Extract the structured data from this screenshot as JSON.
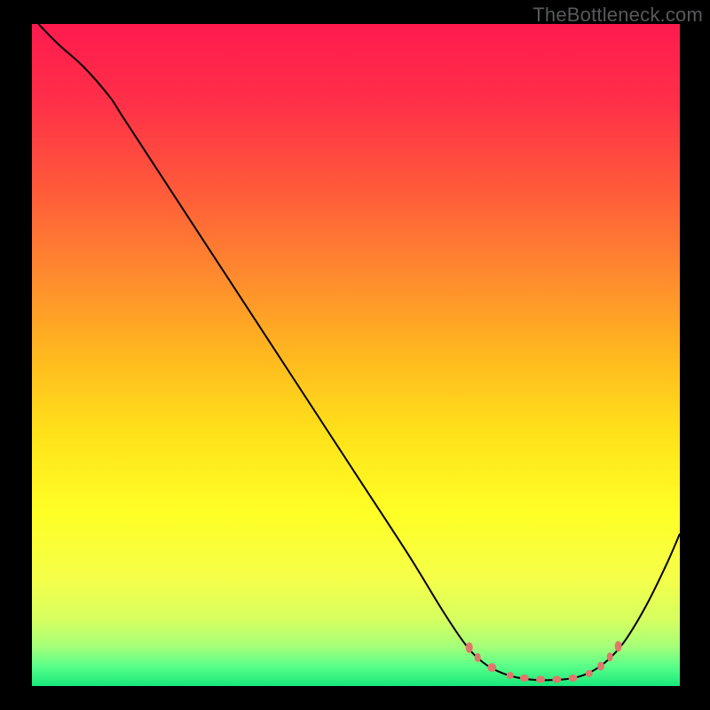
{
  "watermark": "TheBottleneck.com",
  "chart_data": {
    "type": "line",
    "title": "",
    "xlabel": "",
    "ylabel": "",
    "xlim": [
      0,
      100
    ],
    "ylim": [
      0,
      100
    ],
    "background": {
      "type": "vertical-gradient",
      "stops": [
        {
          "offset": 0.0,
          "color": "#ff1a4e"
        },
        {
          "offset": 0.12,
          "color": "#ff3048"
        },
        {
          "offset": 0.25,
          "color": "#ff5a3a"
        },
        {
          "offset": 0.38,
          "color": "#ff8a2e"
        },
        {
          "offset": 0.5,
          "color": "#ffb81f"
        },
        {
          "offset": 0.62,
          "color": "#ffe21a"
        },
        {
          "offset": 0.74,
          "color": "#ffff26"
        },
        {
          "offset": 0.84,
          "color": "#f4ff4a"
        },
        {
          "offset": 0.9,
          "color": "#d6ff60"
        },
        {
          "offset": 0.94,
          "color": "#a6ff78"
        },
        {
          "offset": 0.97,
          "color": "#5aff8a"
        },
        {
          "offset": 1.0,
          "color": "#17e87a"
        }
      ]
    },
    "series": [
      {
        "name": "bottleneck-curve",
        "stroke": "#000000",
        "stroke_width": 2,
        "points": [
          {
            "x": 1.0,
            "y": 100.0
          },
          {
            "x": 4.0,
            "y": 97.0
          },
          {
            "x": 8.0,
            "y": 93.5
          },
          {
            "x": 12.0,
            "y": 89.0
          },
          {
            "x": 14.0,
            "y": 86.0
          },
          {
            "x": 20.0,
            "y": 77.0
          },
          {
            "x": 30.0,
            "y": 62.0
          },
          {
            "x": 40.0,
            "y": 47.0
          },
          {
            "x": 50.0,
            "y": 32.0
          },
          {
            "x": 58.0,
            "y": 20.0
          },
          {
            "x": 63.0,
            "y": 12.0
          },
          {
            "x": 66.0,
            "y": 7.5
          },
          {
            "x": 68.0,
            "y": 5.0
          },
          {
            "x": 70.0,
            "y": 3.3
          },
          {
            "x": 72.0,
            "y": 2.2
          },
          {
            "x": 74.0,
            "y": 1.5
          },
          {
            "x": 76.0,
            "y": 1.1
          },
          {
            "x": 78.0,
            "y": 0.9
          },
          {
            "x": 80.0,
            "y": 0.9
          },
          {
            "x": 82.0,
            "y": 1.0
          },
          {
            "x": 84.0,
            "y": 1.3
          },
          {
            "x": 86.0,
            "y": 2.0
          },
          {
            "x": 88.0,
            "y": 3.2
          },
          {
            "x": 90.0,
            "y": 5.0
          },
          {
            "x": 92.0,
            "y": 7.5
          },
          {
            "x": 95.0,
            "y": 12.5
          },
          {
            "x": 98.0,
            "y": 18.5
          },
          {
            "x": 100.0,
            "y": 23.0
          }
        ]
      }
    ],
    "markers": {
      "name": "optimal-points",
      "fill": "#e0776d",
      "points": [
        {
          "x": 67.5,
          "y": 5.8,
          "rx": 4,
          "ry": 6
        },
        {
          "x": 68.8,
          "y": 4.3,
          "rx": 3.5,
          "ry": 5
        },
        {
          "x": 71.0,
          "y": 2.8,
          "rx": 5,
          "ry": 5
        },
        {
          "x": 73.8,
          "y": 1.6,
          "rx": 4,
          "ry": 4
        },
        {
          "x": 76.0,
          "y": 1.2,
          "rx": 5,
          "ry": 4
        },
        {
          "x": 78.5,
          "y": 1.0,
          "rx": 5,
          "ry": 4
        },
        {
          "x": 81.0,
          "y": 1.0,
          "rx": 5,
          "ry": 4
        },
        {
          "x": 83.5,
          "y": 1.2,
          "rx": 5,
          "ry": 4
        },
        {
          "x": 86.0,
          "y": 1.9,
          "rx": 4,
          "ry": 4
        },
        {
          "x": 87.8,
          "y": 3.0,
          "rx": 4,
          "ry": 5
        },
        {
          "x": 89.2,
          "y": 4.4,
          "rx": 3.5,
          "ry": 5
        },
        {
          "x": 90.5,
          "y": 6.0,
          "rx": 4,
          "ry": 6
        }
      ]
    }
  }
}
